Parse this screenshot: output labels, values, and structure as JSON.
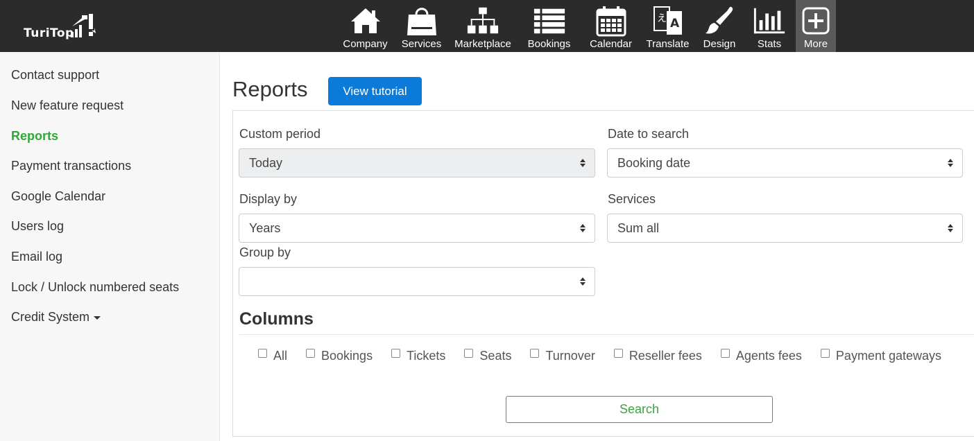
{
  "brand": {
    "name": "TuriTop"
  },
  "nav": [
    {
      "label": "Company",
      "icon": "home-icon"
    },
    {
      "label": "Services",
      "icon": "shopping-bag-icon"
    },
    {
      "label": "Marketplace",
      "icon": "sitemap-icon"
    },
    {
      "label": "Bookings",
      "icon": "list-icon"
    },
    {
      "label": "Calendar",
      "icon": "calendar-icon"
    },
    {
      "label": "Translate",
      "icon": "translate-icon"
    },
    {
      "label": "Design",
      "icon": "paintbrush-icon"
    },
    {
      "label": "Stats",
      "icon": "bar-chart-icon"
    },
    {
      "label": "More",
      "icon": "plus-square-icon",
      "active": true
    }
  ],
  "sidebar": {
    "items": [
      {
        "label": "Contact support"
      },
      {
        "label": "New feature request"
      },
      {
        "label": "Reports",
        "active": true
      },
      {
        "label": "Payment transactions"
      },
      {
        "label": "Google Calendar"
      },
      {
        "label": "Users log"
      },
      {
        "label": "Email log"
      },
      {
        "label": "Lock / Unlock numbered seats"
      },
      {
        "label": "Credit System"
      }
    ]
  },
  "main": {
    "title": "Reports",
    "tutorial_button": "View tutorial",
    "fields": {
      "custom_period": {
        "label": "Custom period",
        "value": "Today"
      },
      "date_to_search": {
        "label": "Date to search",
        "value": "Booking date"
      },
      "display_by": {
        "label": "Display by",
        "value": "Years"
      },
      "services": {
        "label": "Services",
        "value": "Sum all"
      },
      "group_by": {
        "label": "Group by",
        "value": ""
      }
    },
    "columns": {
      "title": "Columns",
      "options": [
        "All",
        "Bookings",
        "Tickets",
        "Seats",
        "Turnover",
        "Reseller fees",
        "Agents fees",
        "Payment gateways"
      ]
    },
    "search_button": "Search"
  },
  "colors": {
    "topbar": "#2b2b2b",
    "active_nav": "#5a5a5a",
    "primary_button": "#0b7ad8",
    "active_sidebar": "#2ea836",
    "search_button": "#3ea043"
  }
}
